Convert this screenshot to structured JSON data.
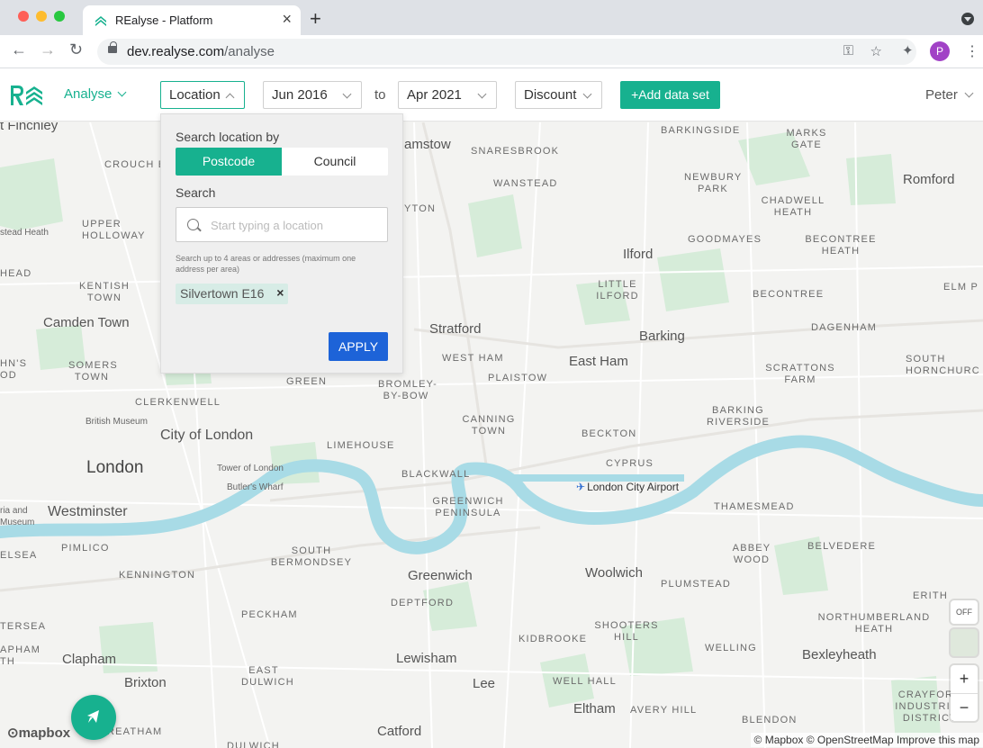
{
  "browser": {
    "tab_title": "REalyse - Platform",
    "url_host": "dev.realyse.com",
    "url_path": "/analyse",
    "profile_initial": "P"
  },
  "header": {
    "nav_label": "Analyse",
    "location_label": "Location",
    "from_date": "Jun 2016",
    "to_label": "to",
    "to_date": "Apr 2021",
    "metric_label": "Discount",
    "add_button": "+Add data set",
    "user_name": "Peter",
    "brand_color": "#17b18f"
  },
  "location_panel": {
    "search_by_label": "Search location by",
    "options": [
      "Postcode",
      "Council"
    ],
    "selected_option": "Postcode",
    "search_label": "Search",
    "search_placeholder": "Start typing a location",
    "hint": "Search up to 4 areas or addresses (maximum one address per area)",
    "selected_areas": [
      "Silvertown E16"
    ],
    "apply_label": "APPLY",
    "apply_color": "#1d63d8"
  },
  "map": {
    "places": [
      {
        "name": "t Finchley",
        "style": "big"
      },
      {
        "name": "CROUCH END",
        "style": "caps"
      },
      {
        "name": "UPPER HOLLOWAY",
        "style": "caps"
      },
      {
        "name": "stead Heath",
        "style": "small"
      },
      {
        "name": "KENTISH TOWN",
        "style": "caps"
      },
      {
        "name": "Camden Town",
        "style": "big"
      },
      {
        "name": "SOMERS TOWN",
        "style": "caps"
      },
      {
        "name": "CLERKENWELL",
        "style": "caps"
      },
      {
        "name": "British Museum",
        "style": "small"
      },
      {
        "name": "City of London",
        "style": "big"
      },
      {
        "name": "London",
        "style": "xbig"
      },
      {
        "name": "Tower of London",
        "style": "small"
      },
      {
        "name": "Butler's Wharf",
        "style": "small"
      },
      {
        "name": "Westminster",
        "style": "big"
      },
      {
        "name": "PIMLICO",
        "style": "caps"
      },
      {
        "name": "KENNINGTON",
        "style": "caps"
      },
      {
        "name": "SOUTH BERMONDSEY",
        "style": "caps"
      },
      {
        "name": "PECKHAM",
        "style": "caps"
      },
      {
        "name": "Clapham",
        "style": "big"
      },
      {
        "name": "EAST DULWICH",
        "style": "caps"
      },
      {
        "name": "Brixton",
        "style": "big"
      },
      {
        "name": "amstow",
        "style": "big"
      },
      {
        "name": "SNARESBROOK",
        "style": "caps"
      },
      {
        "name": "WANSTEAD",
        "style": "caps"
      },
      {
        "name": "YTON",
        "style": "caps"
      },
      {
        "name": "Stratford",
        "style": "big"
      },
      {
        "name": "WEST HAM",
        "style": "caps"
      },
      {
        "name": "PLAISTOW",
        "style": "caps"
      },
      {
        "name": "BROMLEY-BY-BOW",
        "style": "caps"
      },
      {
        "name": "GREEN",
        "style": "caps"
      },
      {
        "name": "LIMEHOUSE",
        "style": "caps"
      },
      {
        "name": "CANNING TOWN",
        "style": "caps"
      },
      {
        "name": "BLACKWALL",
        "style": "caps"
      },
      {
        "name": "GREENWICH PENINSULA",
        "style": "caps"
      },
      {
        "name": "Greenwich",
        "style": "big"
      },
      {
        "name": "DEPTFORD",
        "style": "caps"
      },
      {
        "name": "Lewisham",
        "style": "big"
      },
      {
        "name": "Lee",
        "style": "big"
      },
      {
        "name": "BARKINGSIDE",
        "style": "caps"
      },
      {
        "name": "MARKS GATE",
        "style": "caps"
      },
      {
        "name": "NEWBURY PARK",
        "style": "caps"
      },
      {
        "name": "CHADWELL HEATH",
        "style": "caps"
      },
      {
        "name": "Romford",
        "style": "big"
      },
      {
        "name": "GOODMAYES",
        "style": "caps"
      },
      {
        "name": "BECONTREE HEATH",
        "style": "caps"
      },
      {
        "name": "Ilford",
        "style": "big"
      },
      {
        "name": "LITTLE ILFORD",
        "style": "caps"
      },
      {
        "name": "BECONTREE",
        "style": "caps"
      },
      {
        "name": "ELM P",
        "style": "caps"
      },
      {
        "name": "Barking",
        "style": "big"
      },
      {
        "name": "DAGENHAM",
        "style": "caps"
      },
      {
        "name": "East Ham",
        "style": "big"
      },
      {
        "name": "SCRATTONS FARM",
        "style": "caps"
      },
      {
        "name": "SOUTH HORNCHURC",
        "style": "caps"
      },
      {
        "name": "BARKING RIVERSIDE",
        "style": "caps"
      },
      {
        "name": "BECKTON",
        "style": "caps"
      },
      {
        "name": "CYPRUS",
        "style": "caps"
      },
      {
        "name": "THAMESMEAD",
        "style": "caps"
      },
      {
        "name": "ABBEY WOOD",
        "style": "caps"
      },
      {
        "name": "BELVEDERE",
        "style": "caps"
      },
      {
        "name": "Woolwich",
        "style": "big"
      },
      {
        "name": "PLUMSTEAD",
        "style": "caps"
      },
      {
        "name": "ERITH",
        "style": "caps"
      },
      {
        "name": "NORTHUMBERLAND HEATH",
        "style": "caps"
      },
      {
        "name": "SHOOTERS HILL",
        "style": "caps"
      },
      {
        "name": "KIDBROOKE",
        "style": "caps"
      },
      {
        "name": "WELLING",
        "style": "caps"
      },
      {
        "name": "Bexleyheath",
        "style": "big"
      },
      {
        "name": "WELL HALL",
        "style": "caps"
      },
      {
        "name": "AVERY HILL",
        "style": "caps"
      },
      {
        "name": "Eltham",
        "style": "big"
      },
      {
        "name": "CRAYFORD INDUSTRIAL DISTRICT",
        "style": "caps"
      },
      {
        "name": "BLENDON",
        "style": "caps"
      },
      {
        "name": "Catford",
        "style": "big"
      },
      {
        "name": "REATHAM",
        "style": "caps"
      },
      {
        "name": "DULWICH",
        "style": "caps"
      },
      {
        "name": "ELSEA",
        "style": "caps"
      },
      {
        "name": "HN'S OD",
        "style": "caps"
      },
      {
        "name": "HEAD",
        "style": "caps"
      },
      {
        "name": "TERSEA",
        "style": "caps"
      },
      {
        "name": "APHAM TH",
        "style": "caps"
      },
      {
        "name": "ria and Museum",
        "style": "small"
      }
    ],
    "airport_label": "London City Airport",
    "layer_toggle": "OFF",
    "zoom_in": "+",
    "zoom_out": "−",
    "mapbox_logo": "mapbox",
    "attribution": "© Mapbox © OpenStreetMap Improve this map"
  }
}
